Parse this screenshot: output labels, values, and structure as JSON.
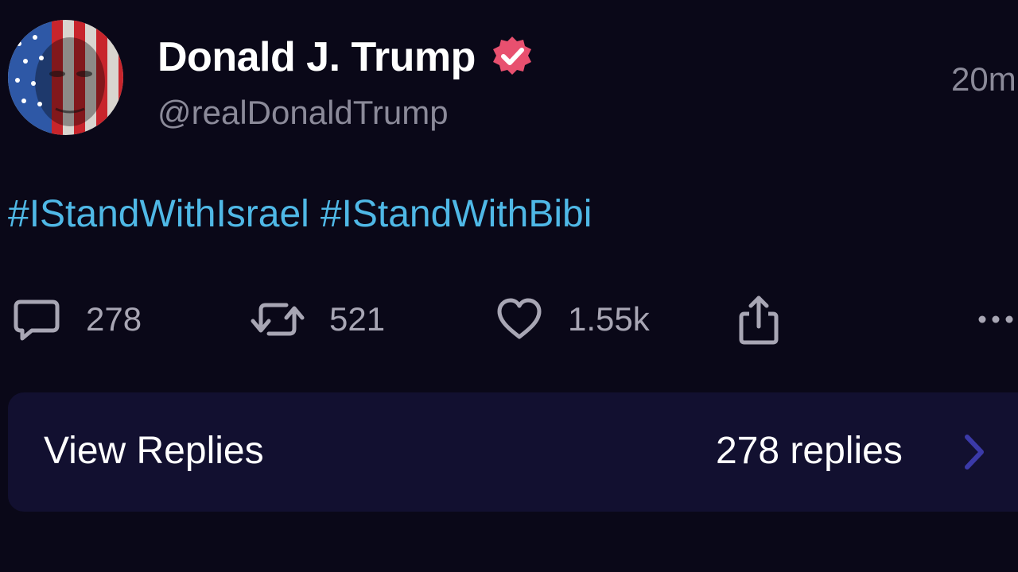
{
  "post": {
    "author": {
      "display_name": "Donald J. Trump",
      "handle": "@realDonaldTrump",
      "verified": true,
      "avatar_icon": "flag-portrait-avatar",
      "badge_color": "#e8506f"
    },
    "timestamp": "20m",
    "body": {
      "hashtags": [
        "#IStandWithIsrael",
        "#IStandWithBibi"
      ],
      "hashtag_color": "#4fb8e6"
    },
    "actions": {
      "reply": {
        "icon": "comment-icon",
        "count": "278"
      },
      "repost": {
        "icon": "repost-icon",
        "count": "521"
      },
      "like": {
        "icon": "heart-icon",
        "count": "1.55k"
      },
      "share": {
        "icon": "share-icon"
      },
      "more": {
        "icon": "more-icon"
      }
    },
    "view_replies": {
      "label": "View Replies",
      "count_label": "278 replies",
      "chevron_color": "#3b3aa8"
    }
  },
  "theme": {
    "background": "#0a0818",
    "card_background": "#121030",
    "muted_text": "#8b8a99"
  }
}
